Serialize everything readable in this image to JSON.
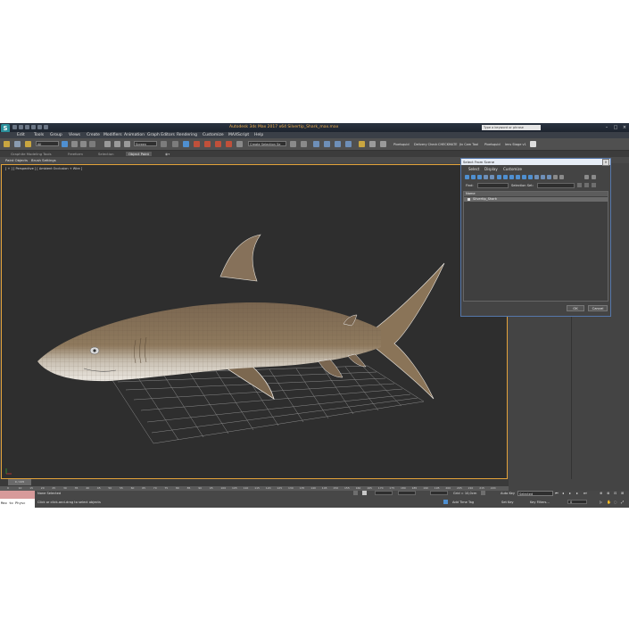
{
  "window": {
    "title": "Autodesk 3ds Max 2017 x64    Silvertip_Shark_max.max",
    "search_placeholder": "Type a keyword or phrase"
  },
  "menu": [
    "Edit",
    "Tools",
    "Group",
    "Views",
    "Create",
    "Modifiers",
    "Animation",
    "Graph Editors",
    "Rendering",
    "Customize",
    "MAXScript",
    "Help"
  ],
  "toolbar": {
    "filter_value": "All",
    "coord_value": "Screen",
    "selection_set": "Create Selection Se",
    "labels": [
      "Pixelsquid",
      "Delivery Check",
      "CHECKMATE",
      "Jiv Cam Tool",
      "Pixelsquid",
      "lens Stage v1"
    ]
  },
  "ribbon_tabs": [
    "Graphite Modeling Tools",
    "Freeform",
    "Selection",
    "Object Paint"
  ],
  "ribbon_active": "Object Paint",
  "subribbon": [
    "Paint Objects",
    "Brush Settings"
  ],
  "viewport_label": "[ + ] [ Perspective ] [ Ambient Occlusion + Wire ]",
  "timeline": {
    "slider": "0 / 225",
    "ticks": [
      "0",
      "10",
      "15",
      "20",
      "25",
      "30",
      "35",
      "40",
      "45",
      "50",
      "55",
      "60",
      "65",
      "70",
      "75",
      "80",
      "85",
      "90",
      "95",
      "100",
      "105",
      "110",
      "115",
      "120",
      "125",
      "130",
      "135",
      "140",
      "145",
      "150",
      "155",
      "160",
      "165",
      "170",
      "175",
      "180",
      "185",
      "190",
      "195",
      "200",
      "205",
      "210",
      "215",
      "220"
    ]
  },
  "status": {
    "maxscript": "Max to Physc",
    "selection": "None Selected",
    "prompt": "Click or click-and-drag to select objects",
    "grid": "Grid = 10,0cm",
    "add_time_tag": "Add Time Tag",
    "auto_key": "Auto Key",
    "auto_key_value": "Selected",
    "set_key": "Set Key",
    "key_filters": "Key Filters...",
    "frame": "0"
  },
  "dialog": {
    "title": "Select From Scene",
    "menu": [
      "Select",
      "Display",
      "Customize"
    ],
    "find_label": "Find:",
    "selection_set_label": "Selection Set:",
    "column_header": "Name",
    "items": [
      "Silvertip_Shark"
    ],
    "ok": "OK",
    "cancel": "Cancel"
  },
  "colors": {
    "accent": "#e3a23a",
    "shark_body": "#8a7358",
    "shark_belly": "#e6e2da",
    "grid": "#8a8a8a"
  }
}
